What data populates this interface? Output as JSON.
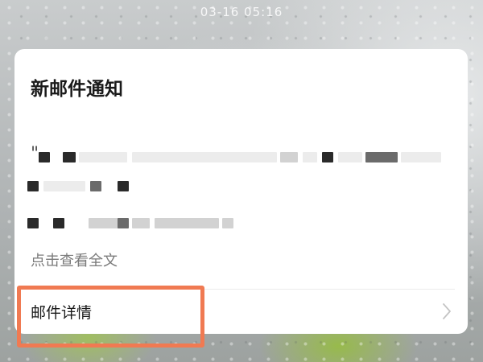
{
  "status_bar": {
    "time": "03-16 05:16"
  },
  "notification": {
    "title": "新邮件通知",
    "quote_mark": "\"",
    "view_full_label": "点击查看全文",
    "detail_label": "邮件详情"
  },
  "colors": {
    "highlight": "#f07a52",
    "card_background": "#ffffff",
    "title_text": "#1a1a1a",
    "secondary_text": "#7a7a7a"
  },
  "icons": {
    "detail_chevron": "chevron-right-icon"
  }
}
